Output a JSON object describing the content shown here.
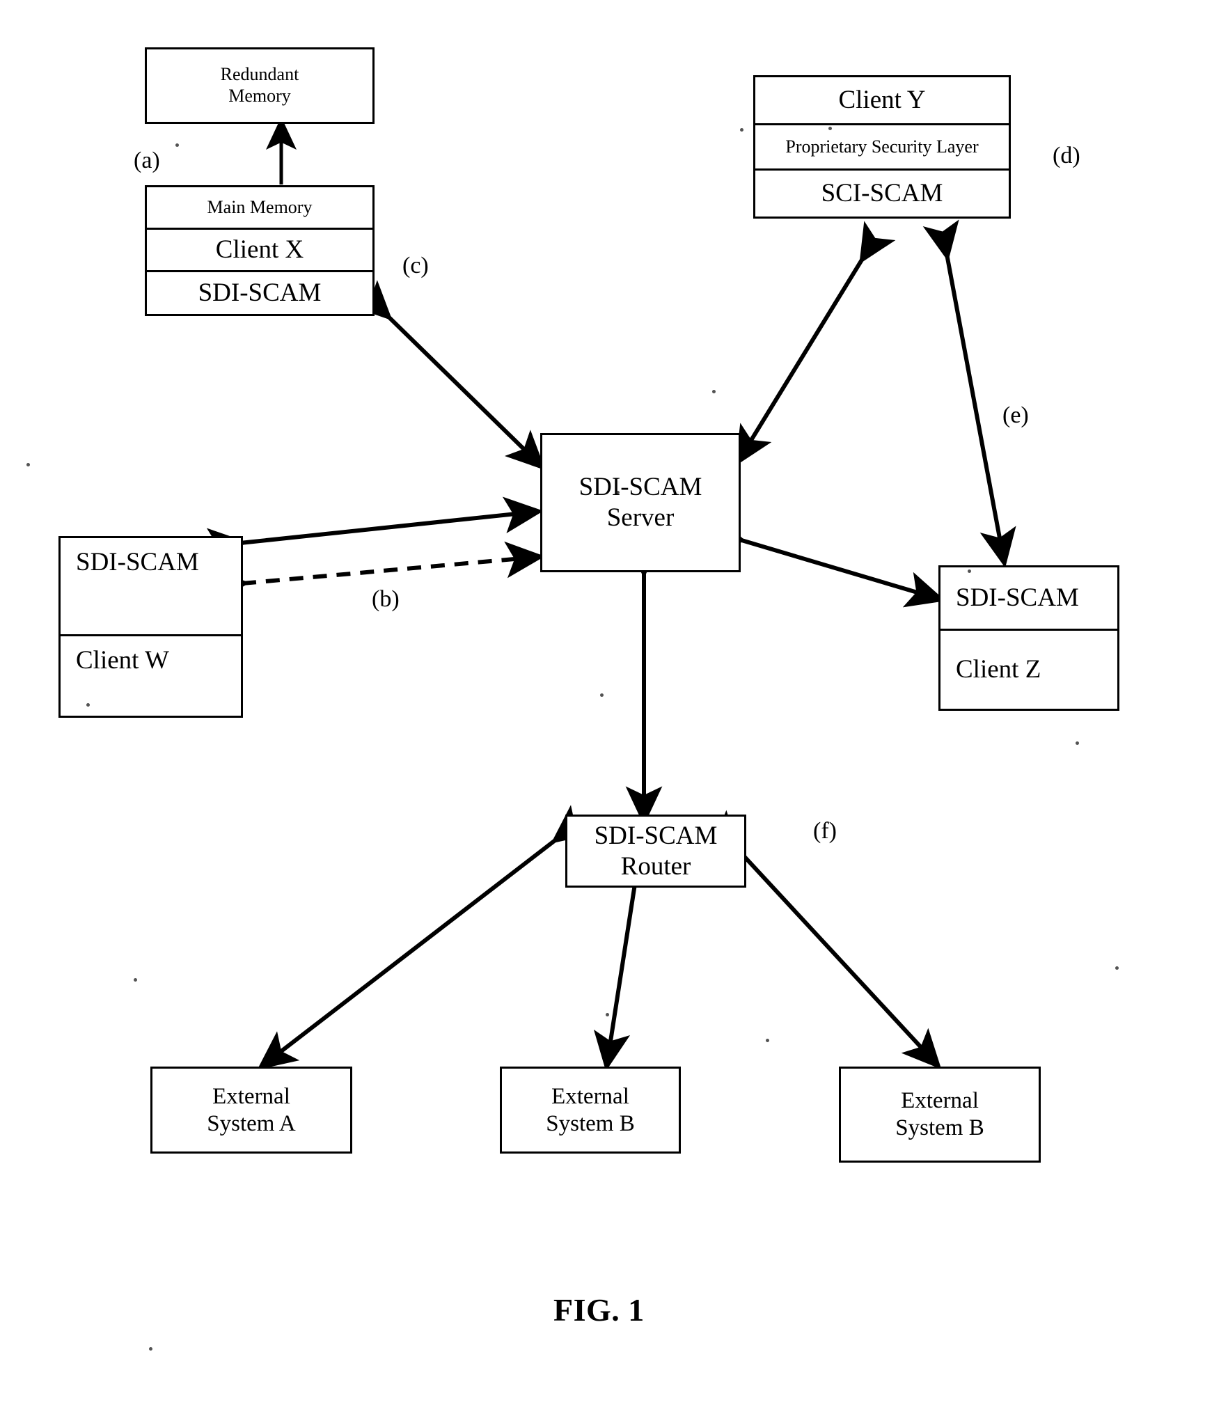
{
  "figure": {
    "caption": "FIG. 1",
    "title": "SDI-SCAM network architecture diagram"
  },
  "nodes": {
    "redundant_memory": {
      "label": "Redundant\nMemory",
      "line1": "Redundant",
      "line2": "Memory"
    },
    "client_x_stack": {
      "main_memory": "Main Memory",
      "client": "Client X",
      "agent": "SDI-SCAM"
    },
    "client_y_stack": {
      "client": "Client Y",
      "security_layer": "Proprietary Security Layer",
      "agent": "SCI-SCAM"
    },
    "client_w_stack": {
      "agent": "SDI-SCAM",
      "client": "Client W"
    },
    "client_z_stack": {
      "agent": "SDI-SCAM",
      "client": "Client Z"
    },
    "server": {
      "line1": "SDI-SCAM",
      "line2": "Server"
    },
    "router": {
      "line1": "SDI-SCAM",
      "line2": "Router"
    },
    "external_a": {
      "line1": "External",
      "line2": "System A"
    },
    "external_b1": {
      "line1": "External",
      "line2": "System B"
    },
    "external_b2": {
      "line1": "External",
      "line2": "System B"
    }
  },
  "callouts": {
    "a": "(a)",
    "b": "(b)",
    "c": "(c)",
    "d": "(d)",
    "e": "(e)",
    "f": "(f)"
  },
  "colors": {
    "ink": "#000000",
    "paper": "#ffffff"
  }
}
